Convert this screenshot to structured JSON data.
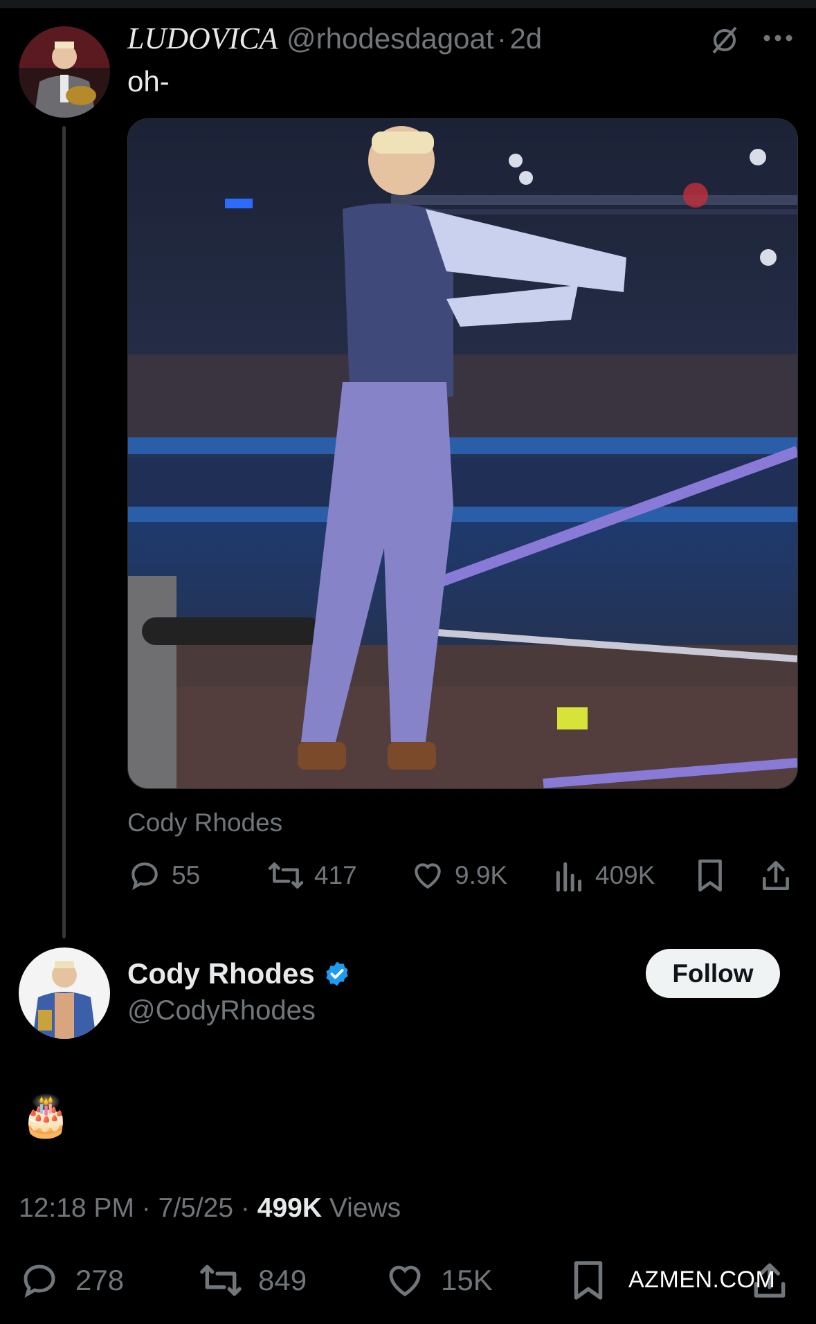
{
  "quoted_post": {
    "display_name": "LUDOVICA",
    "handle": "@rhodesdagoat",
    "separator": "·",
    "age": "2d",
    "text": "oh-",
    "media_caption": "Cody Rhodes",
    "actions": {
      "replies": "55",
      "reposts": "417",
      "likes": "9.9K",
      "views": "409K"
    }
  },
  "main_post": {
    "display_name": "Cody Rhodes",
    "handle": "@CodyRhodes",
    "follow_label": "Follow",
    "text": "🎂",
    "time": "12:18 PM",
    "date": "7/5/25",
    "views_count": "499K",
    "views_label": "Views",
    "sep": "·",
    "actions": {
      "replies": "278",
      "reposts": "849",
      "likes": "15K"
    }
  },
  "watermark": "AZMEN.COM",
  "colors": {
    "background": "#000000",
    "text_primary": "#e7e9ea",
    "text_secondary": "#71767b",
    "verified": "#1d9bf0",
    "follow_bg": "#eff3f4"
  },
  "icons": [
    "mute-icon",
    "more-icon",
    "reply-icon",
    "repost-icon",
    "like-icon",
    "views-icon",
    "bookmark-icon",
    "share-icon",
    "verified-badge-icon"
  ]
}
